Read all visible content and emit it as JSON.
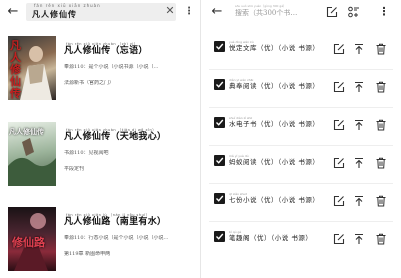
{
  "left": {
    "back_glyph": "←",
    "search_ruby": "fán rén xiū xiān zhuàn",
    "search_value": "凡人修仙传",
    "clear_glyph": "✕",
    "more_glyph": "⋮",
    "results": [
      {
        "title_ruby": "fán rén xiū xiān zhuàn （zhì yì）",
        "title": "凡人修仙传（忘语）",
        "line1": "奉源110：是个小说（小说书源（小说（…",
        "line2": "法源新书（官药之门）",
        "cover_text": "凡人修仙传"
      },
      {
        "title_ruby": "fán rén xiū xiān zhuàn （tiān dì wǒ xīn）",
        "title": "凡人修仙传（天地我心）",
        "line1": "书源110：见视阅吧",
        "line2": "平段定刊",
        "cover_text": "凡人修仙传"
      },
      {
        "title_ruby": "fán rén xiū xiān lù （nán lǐ yǒu shuǐ）",
        "title": "凡人修仙路（南里有水）",
        "line1": "奉源110：行态小说（是个小说（小说（小说…",
        "line2": "第119章 新图命申两",
        "cover_text": "修仙路"
      }
    ]
  },
  "right": {
    "back_glyph": "←",
    "search_ruby": "sōu suǒ shū yuán（gòng 300 gè）",
    "search_placeholder": "搜索（共300个书…",
    "sources": [
      {
        "ruby": "yuè dìng wén kù",
        "label": "悦定文库（优）（小说 书源）"
      },
      {
        "ruby": "diǎn yī wén zhāi",
        "label": "典奉阅读（优）（小说 书源）"
      },
      {
        "ruby": "shuǐ diàn zǐ shū",
        "label": "水电子书（优）（小说 书源）"
      },
      {
        "ruby": "mǎ yǐ yuè dú",
        "label": "蚂蚁阅读（优）（小说 书源）"
      },
      {
        "ruby": "qī xiǎo shuō",
        "label": "七份小说（优）（小说 书源）"
      },
      {
        "ruby": "bǐ qù gé",
        "label": "笔趣阁（优）（小说 书源）"
      }
    ]
  }
}
